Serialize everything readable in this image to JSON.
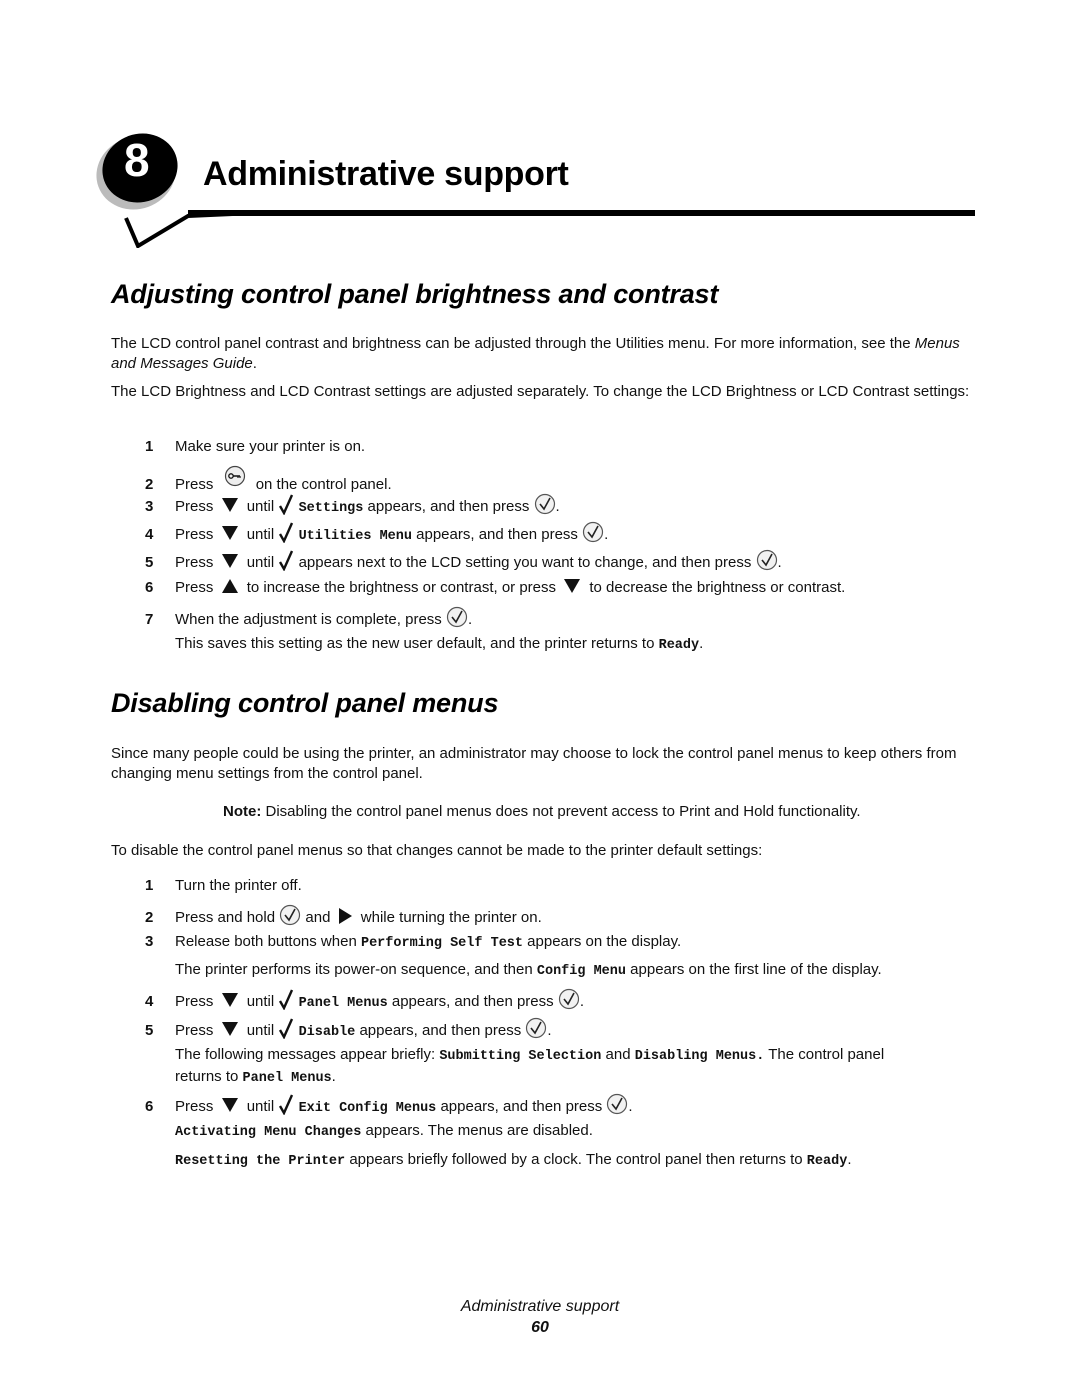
{
  "chapter": {
    "number": "8",
    "title": "Administrative support"
  },
  "section1": {
    "heading": "Adjusting control panel brightness and contrast",
    "intro1_text": "The LCD control panel contrast and brightness can be adjusted through the Utilities menu. For more information, see the ",
    "intro1_ref": "Menus and Messages Guide",
    "intro1_end": ".",
    "intro2": "The LCD Brightness and LCD Contrast settings are adjusted separately. To change the LCD Brightness or LCD Contrast settings:",
    "steps": [
      {
        "num": "1",
        "text": "Make sure your printer is on."
      },
      {
        "num": "2",
        "pre": "Press",
        "post": "on the control panel.",
        "icon": "menu-key-button-icon"
      },
      {
        "num": "3",
        "pre": "Press",
        "mid": "until",
        "code": "Settings",
        "post": "appears, and then press",
        "end": "."
      },
      {
        "num": "4",
        "pre": "Press",
        "mid": "until",
        "code": "Utilities Menu",
        "post": "appears, and then press",
        "end": "."
      },
      {
        "num": "5",
        "pre": "Press",
        "mid": "until",
        "post": "appears next to the LCD setting you want to change, and then press",
        "end": "."
      },
      {
        "num": "6",
        "pre": "Press",
        "mid": "to increase the brightness or contrast, or press",
        "post": "to decrease the brightness or contrast."
      },
      {
        "num": "7",
        "pre": "When the adjustment is complete, press",
        "end": "."
      }
    ],
    "step7_note_pre": "This saves this setting as the new user default, and the printer returns to ",
    "step7_note_code": "Ready",
    "step7_note_end": "."
  },
  "section2": {
    "heading": "Disabling control panel menus",
    "intro": "Since many people could be using the printer, an administrator may choose to lock the control panel menus to keep others from changing menu settings from the control panel.",
    "note_label": "Note:",
    "note_text": "Disabling the control panel menus does not prevent access to Print and Hold functionality.",
    "lead": "To disable the control panel menus so that changes cannot be made to the printer default settings:",
    "steps": [
      {
        "num": "1",
        "text": "Turn the printer off."
      },
      {
        "num": "2",
        "pre": "Press and hold",
        "mid": "and",
        "post": "while turning the printer on."
      },
      {
        "num": "3",
        "pre": "Release both buttons when",
        "code": "Performing Self Test",
        "post": "appears on the display."
      },
      {
        "num": "4",
        "pre": "Press",
        "mid": "until",
        "code": "Panel Menus",
        "post": "appears, and then press",
        "end": "."
      },
      {
        "num": "5",
        "pre": "Press",
        "mid": "until",
        "code": "Disable",
        "post": "appears, and then press",
        "end": "."
      },
      {
        "num": "6",
        "pre": "Press",
        "mid": "until",
        "code": "Exit Config Menus",
        "post": "appears, and then press",
        "end": "."
      }
    ],
    "step3_note_pre": "The printer performs its power-on sequence, and then",
    "step3_note_code": "Config Menu",
    "step3_note_post": "appears on the first line of the display.",
    "step5_note_pre": "The following messages appear briefly:",
    "step5_note_code1": "Submitting Selection",
    "step5_note_and": "and",
    "step5_note_code2": "Disabling Menus.",
    "step5_note_post": "The control panel",
    "step5_note_line2_pre": "returns to",
    "step5_note_line2_code": "Panel Menus",
    "step5_note_line2_end": ".",
    "step6_note1_code": "Activating Menu Changes",
    "step6_note1_text": "appears. The menus are disabled.",
    "step6_note2_code": "Resetting the Printer",
    "step6_note2_text": "appears briefly followed by a clock. The control panel then returns to",
    "step6_note2_code2": "Ready",
    "step6_note2_end": "."
  },
  "footer": {
    "title": "Administrative support",
    "page": "60"
  }
}
